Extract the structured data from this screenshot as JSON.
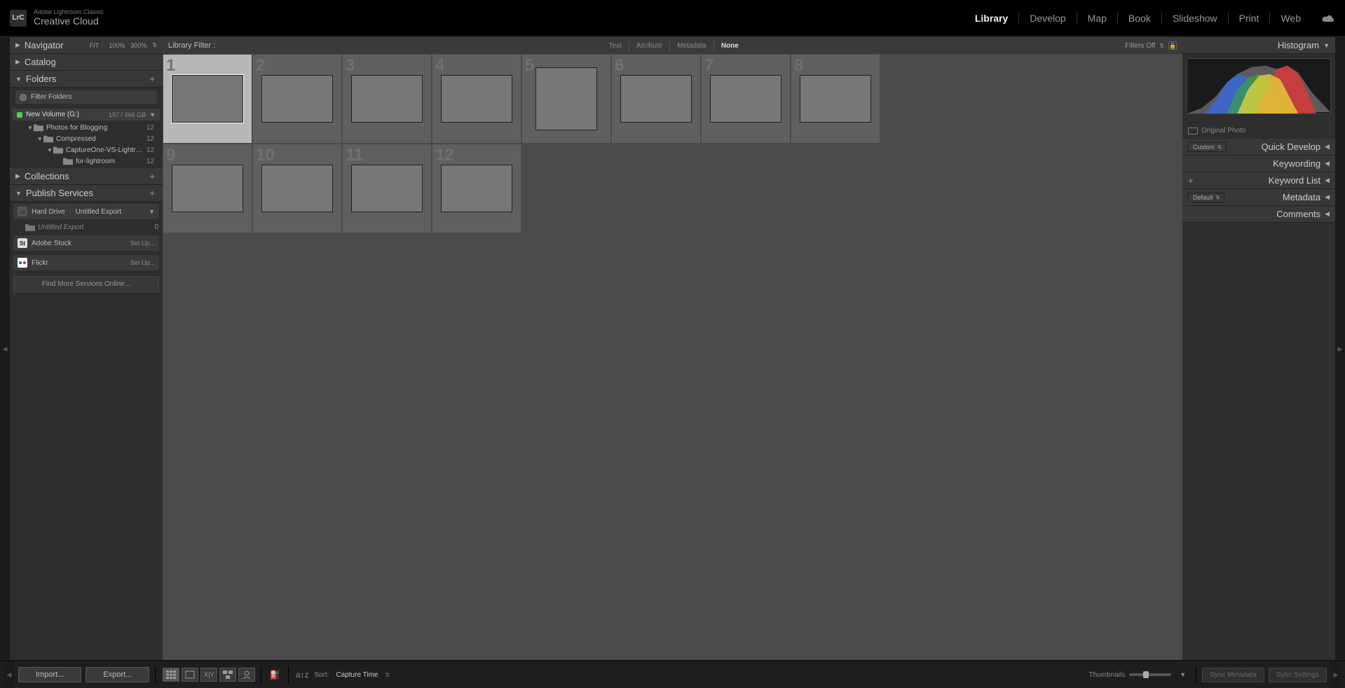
{
  "app": {
    "product_small": "Adobe Lightroom Classic",
    "product_big": "Creative Cloud",
    "logo_text": "LrC"
  },
  "modules": [
    "Library",
    "Develop",
    "Map",
    "Book",
    "Slideshow",
    "Print",
    "Web"
  ],
  "active_module": "Library",
  "left": {
    "navigator": {
      "label": "Navigator",
      "fit": "FIT",
      "p100": "100%",
      "p300": "300%"
    },
    "catalog": {
      "label": "Catalog"
    },
    "folders": {
      "label": "Folders",
      "filter_placeholder": "Filter Folders",
      "volume_name": "New Volume (G:)",
      "volume_size": "197 / 466 GB",
      "tree": [
        {
          "indent": 1,
          "name": "Photos for Blogging",
          "count": "12",
          "open": true
        },
        {
          "indent": 2,
          "name": "Compressed",
          "count": "12",
          "open": true
        },
        {
          "indent": 3,
          "name": "CaptureOne-VS-Lightroo...",
          "count": "12",
          "open": true
        },
        {
          "indent": 4,
          "name": "for-lightroom",
          "count": "12",
          "open": false
        }
      ]
    },
    "collections": {
      "label": "Collections"
    },
    "publish": {
      "label": "Publish Services",
      "hard_drive": "Hard Drive",
      "untitled": "Untitled Export",
      "untitled_sub": "Untitled Export",
      "untitled_count": "0",
      "stock": "Adobe Stock",
      "flickr": "Flickr",
      "setup": "Set Up...",
      "find_more": "Find More Services Online..."
    }
  },
  "filter_bar": {
    "title": "Library Filter :",
    "opts": [
      "Text",
      "Attribute",
      "Metadata",
      "None"
    ],
    "active": "None",
    "filters_off": "Filters Off"
  },
  "grid": {
    "items": [
      {
        "n": "1",
        "cls": "p1",
        "selected": true,
        "portrait": false
      },
      {
        "n": "2",
        "cls": "p2",
        "selected": false,
        "portrait": false
      },
      {
        "n": "3",
        "cls": "p3",
        "selected": false,
        "portrait": false
      },
      {
        "n": "4",
        "cls": "p4",
        "selected": false,
        "portrait": false
      },
      {
        "n": "5",
        "cls": "p5",
        "selected": false,
        "portrait": true
      },
      {
        "n": "6",
        "cls": "p6",
        "selected": false,
        "portrait": false
      },
      {
        "n": "7",
        "cls": "p7",
        "selected": false,
        "portrait": false
      },
      {
        "n": "8",
        "cls": "p8",
        "selected": false,
        "portrait": false
      },
      {
        "n": "9",
        "cls": "p9",
        "selected": false,
        "portrait": false
      },
      {
        "n": "10",
        "cls": "p10",
        "selected": false,
        "portrait": false
      },
      {
        "n": "11",
        "cls": "p11",
        "selected": false,
        "portrait": false
      },
      {
        "n": "12",
        "cls": "p12",
        "selected": false,
        "portrait": false
      }
    ]
  },
  "right": {
    "histogram_label": "Histogram",
    "original_photo": "Original Photo",
    "quick_develop": {
      "label": "Quick Develop",
      "preset": "Custom"
    },
    "keywording": "Keywording",
    "keyword_list": "Keyword List",
    "metadata": {
      "label": "Metadata",
      "preset": "Default"
    },
    "comments": "Comments"
  },
  "bottom": {
    "import": "Import...",
    "export": "Export...",
    "sort_label": "Sort:",
    "sort_value": "Capture Time",
    "thumbnails": "Thumbnails",
    "sync_metadata": "Sync Metadata",
    "sync_settings": "Sync Settings"
  }
}
